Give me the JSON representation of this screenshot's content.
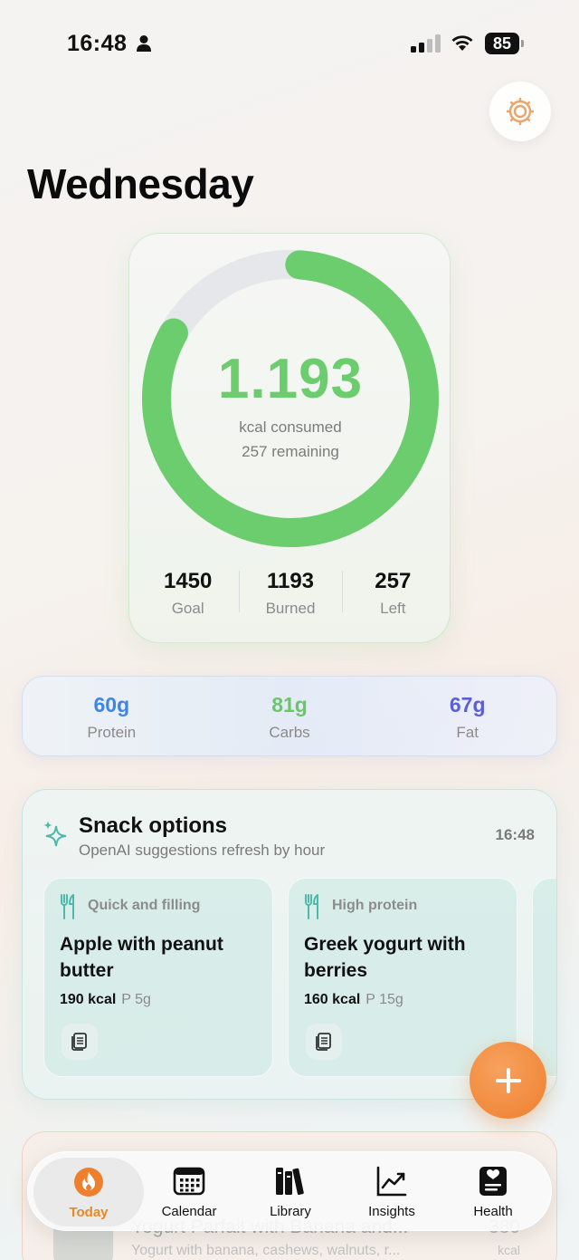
{
  "status_bar": {
    "time": "16:48",
    "battery": "85"
  },
  "header": {
    "title": "Wednesday"
  },
  "calories": {
    "consumed": "1.193",
    "consumed_label": "kcal consumed",
    "remaining_label": "257 remaining",
    "progress_fraction": 0.82,
    "stats": [
      {
        "value": "1450",
        "label": "Goal"
      },
      {
        "value": "1193",
        "label": "Burned"
      },
      {
        "value": "257",
        "label": "Left"
      }
    ],
    "ring_color": "#6ccd6e"
  },
  "macros": [
    {
      "value": "60g",
      "label": "Protein",
      "color": "#3d86e6"
    },
    {
      "value": "81g",
      "label": "Carbs",
      "color": "#6cc46d"
    },
    {
      "value": "67g",
      "label": "Fat",
      "color": "#5a5fd8"
    }
  ],
  "snacks": {
    "title": "Snack options",
    "subtitle": "OpenAI suggestions refresh by hour",
    "time": "16:48",
    "options": [
      {
        "tag": "Quick and filling",
        "name": "Apple with peanut butter",
        "kcal": "190 kcal",
        "protein": "P 5g"
      },
      {
        "tag": "High protein",
        "name": "Greek yogurt with berries",
        "kcal": "160 kcal",
        "protein": "P 15g"
      }
    ]
  },
  "log_entry": {
    "title": "Yogurt Parfait with Banana and...",
    "description": "Yogurt with banana, cashews, walnuts, r...",
    "kcal": "380",
    "unit": "kcal"
  },
  "tabs": [
    {
      "label": "Today",
      "icon": "flame-icon",
      "active": true
    },
    {
      "label": "Calendar",
      "icon": "calendar-icon"
    },
    {
      "label": "Library",
      "icon": "books-icon"
    },
    {
      "label": "Insights",
      "icon": "chart-icon"
    },
    {
      "label": "Health",
      "icon": "health-record-icon"
    }
  ],
  "accent_color": "#ee7f2e"
}
